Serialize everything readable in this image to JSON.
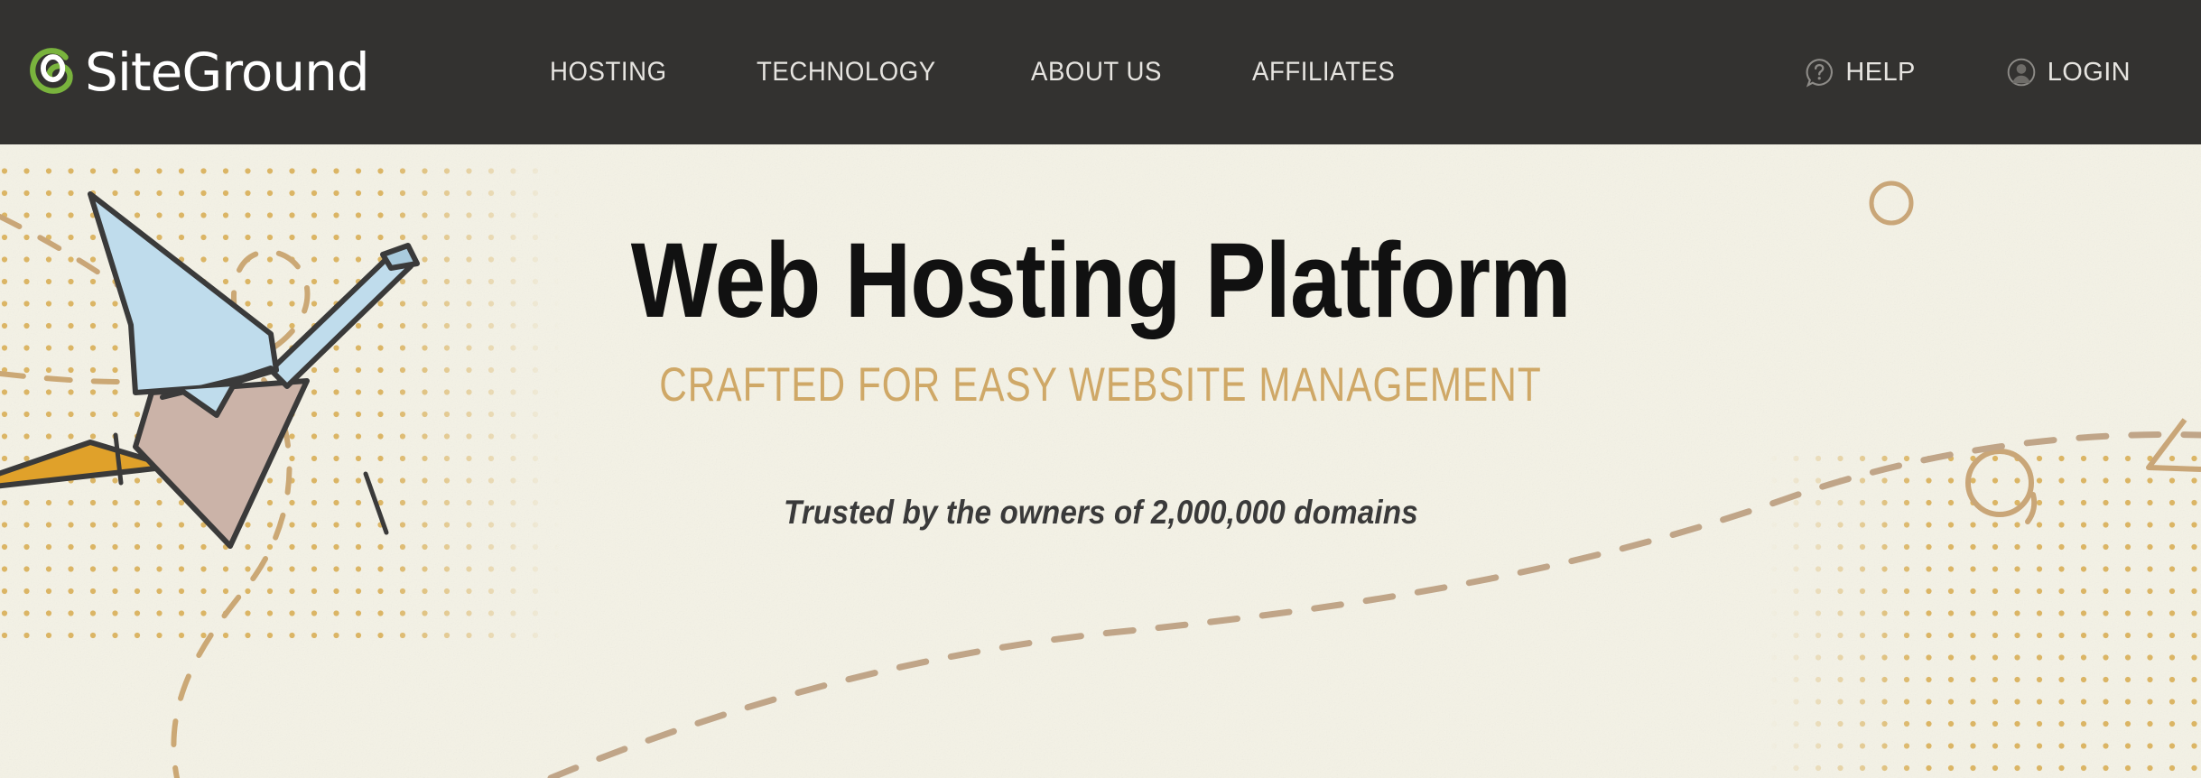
{
  "site": {
    "brand_name": "SiteGround",
    "logo_icon": "siteground-spiral-logo",
    "brand_green": "#79B33D",
    "header_bg": "#333230",
    "hero_bg": "#F4F2E6",
    "accent_tan": "#CFA867",
    "dot_gold": "#D9B05A"
  },
  "header": {
    "nav": [
      {
        "label": "HOSTING",
        "name": "hosting"
      },
      {
        "label": "TECHNOLOGY",
        "name": "technology"
      },
      {
        "label": "ABOUT US",
        "name": "about-us"
      },
      {
        "label": "AFFILIATES",
        "name": "affiliates"
      }
    ],
    "utility": [
      {
        "label": "HELP",
        "name": "help",
        "icon": "question-bubble-icon"
      },
      {
        "label": "LOGIN",
        "name": "login",
        "icon": "user-avatar-icon"
      }
    ]
  },
  "hero": {
    "title": "Web Hosting Platform",
    "subtitle": "CRAFTED FOR EASY WEBSITE MANAGEMENT",
    "trustline": "Trusted by the owners of 2,000,000 domains",
    "illustration": "origami-paper-crane",
    "illustration_colors": {
      "wing": "#BFDCEC",
      "body": "#CBB3A8",
      "beak": "#E0A12A",
      "outline": "#3A3A3A"
    },
    "decorations": [
      "dot-grid",
      "dashed-curve",
      "outline-circle",
      "outline-triangle"
    ]
  }
}
